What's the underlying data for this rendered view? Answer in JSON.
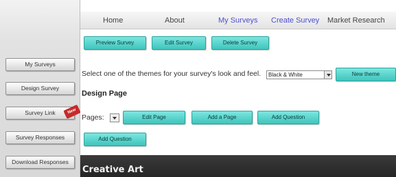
{
  "sidebar": {
    "items": [
      {
        "label": "My Surveys"
      },
      {
        "label": "Design Survey"
      },
      {
        "label": "Survey Link",
        "badge": "New"
      },
      {
        "label": "Survey Responses"
      },
      {
        "label": "Download Responses"
      }
    ]
  },
  "nav": {
    "items": [
      {
        "label": "Home"
      },
      {
        "label": "About"
      },
      {
        "label": "My Surveys"
      },
      {
        "label": "Create Survey"
      },
      {
        "label": "Market Research"
      }
    ]
  },
  "toolbar": {
    "preview_label": "Preview Survey",
    "edit_label": "Edit Survey",
    "delete_label": "Delete Survey"
  },
  "theme": {
    "prompt": "Select one of the themes for your survey's look and feel.",
    "selected": "Black & White",
    "new_theme_label": "New theme"
  },
  "design_page": {
    "heading": "Design Page",
    "pages_label": "Pages:",
    "edit_page_label": "Edit Page",
    "add_page_label": "Add a Page",
    "add_question_label": "Add Question",
    "add_question_label_2": "Add Question"
  },
  "banner": {
    "title": "Creative Art"
  },
  "colors": {
    "accent_teal": "#4fd3cb",
    "nav_link": "#4f4fd0",
    "banner_bg": "#2e2e2e",
    "badge_red": "#c62a2a"
  }
}
